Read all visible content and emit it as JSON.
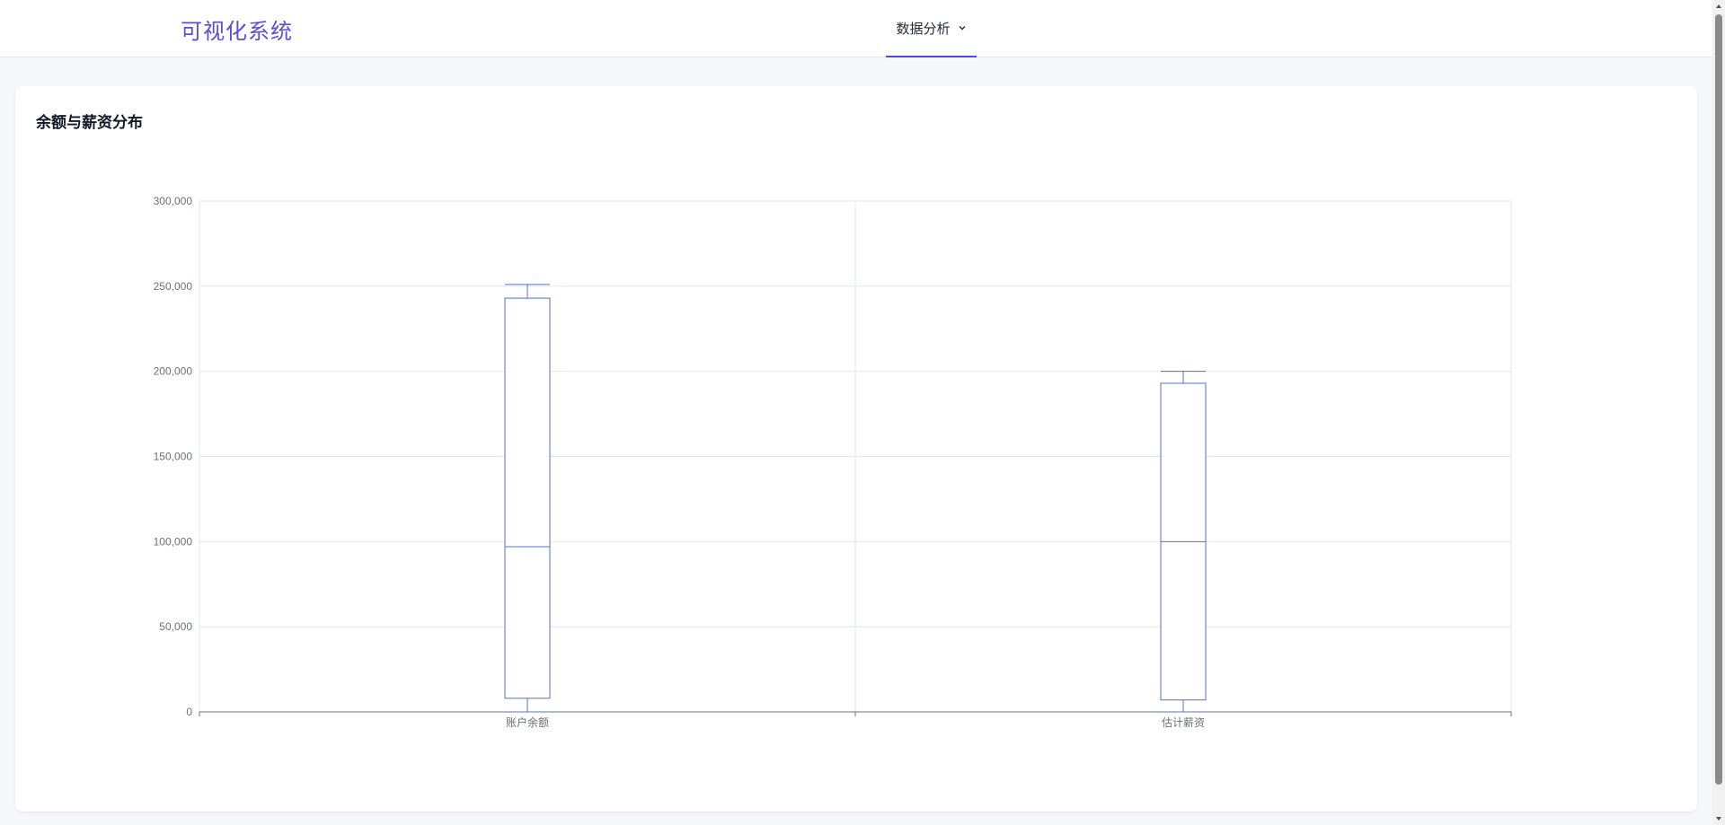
{
  "app": {
    "title": "可视化系统"
  },
  "nav": {
    "tabs": [
      {
        "label": "数据分析",
        "active": true
      }
    ]
  },
  "card": {
    "title": "余额与薪资分布"
  },
  "colors": {
    "brand": "#5b4cdb",
    "accent": "#4f46e5",
    "box_stroke": "#5470c6",
    "grid": "#e0e6f1",
    "axis_text": "#6e7079"
  },
  "chart_data": {
    "type": "boxplot",
    "categories": [
      "账户余额",
      "估计薪资"
    ],
    "series": [
      {
        "values": [
          {
            "min": 0,
            "q1": 8000,
            "median": 97000,
            "q3": 243000,
            "max": 251000
          },
          {
            "min": 0,
            "q1": 7000,
            "median": 100000,
            "q3": 193000,
            "max": 200000
          }
        ]
      }
    ],
    "ylim": [
      0,
      300000
    ],
    "yticks": [
      "0",
      "50,000",
      "100,000",
      "150,000",
      "200,000",
      "250,000",
      "300,000"
    ],
    "ytick_values": [
      0,
      50000,
      100000,
      150000,
      200000,
      250000,
      300000
    ],
    "grid": true,
    "xlabel": "",
    "ylabel": ""
  }
}
